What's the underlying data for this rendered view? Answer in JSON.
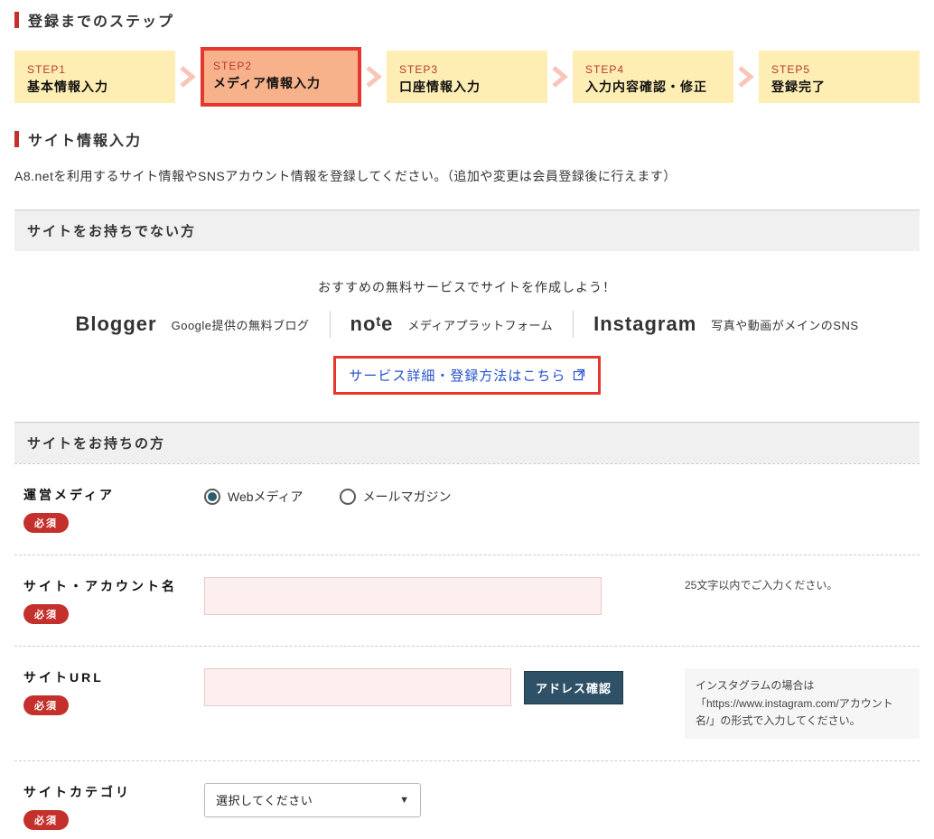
{
  "steps_header": "登録までのステップ",
  "steps": [
    {
      "num": "STEP1",
      "label": "基本情報入力",
      "active": false
    },
    {
      "num": "STEP2",
      "label": "メディア情報入力",
      "active": true
    },
    {
      "num": "STEP3",
      "label": "口座情報入力",
      "active": false
    },
    {
      "num": "STEP4",
      "label": "入力内容確認・修正",
      "active": false
    },
    {
      "num": "STEP5",
      "label": "登録完了",
      "active": false
    }
  ],
  "site_info_header": "サイト情報入力",
  "intro": "A8.netを利用するサイト情報やSNSアカウント情報を登録してください。（追加や変更は会員登録後に行えます）",
  "no_site_header": "サイトをお持ちでない方",
  "recommend_text": "おすすめの無料サービスでサイトを作成しよう！",
  "services": [
    {
      "name": "Blogger",
      "desc": "Google提供の無料ブログ"
    },
    {
      "name": "noᵗe",
      "desc": "メディアプラットフォーム"
    },
    {
      "name": "Instagram",
      "desc": "写真や動画がメインのSNS"
    }
  ],
  "detail_link": "サービス詳細・登録方法はこちら",
  "have_site_header": "サイトをお持ちの方",
  "required_label": "必須",
  "form": {
    "media_label": "運営メディア",
    "media_opt_web": "Webメディア",
    "media_opt_mail": "メールマガジン",
    "sitename_label": "サイト・アカウント名",
    "sitename_help": "25文字以内でご入力ください。",
    "url_label": "サイトURL",
    "url_confirm": "アドレス確認",
    "url_help": "インスタグラムの場合は「https://www.instagram.com/アカウント名/」の形式で入力してください。",
    "category_label": "サイトカテゴリ",
    "category_placeholder": "選択してください"
  }
}
